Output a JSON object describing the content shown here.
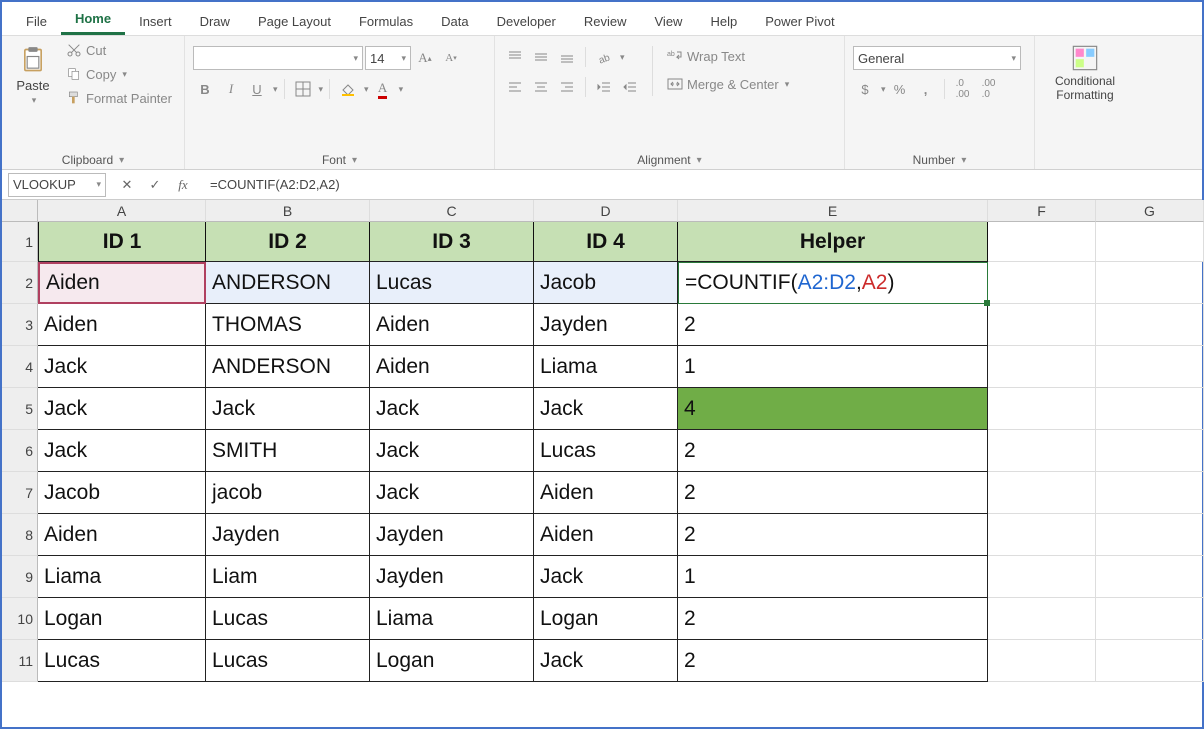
{
  "tabs": [
    "File",
    "Home",
    "Insert",
    "Draw",
    "Page Layout",
    "Formulas",
    "Data",
    "Developer",
    "Review",
    "View",
    "Help",
    "Power Pivot"
  ],
  "active_tab": "Home",
  "ribbon": {
    "clipboard": {
      "paste": "Paste",
      "cut": "Cut",
      "copy": "Copy",
      "format_painter": "Format Painter",
      "label": "Clipboard"
    },
    "font": {
      "name": "",
      "size": "14",
      "label": "Font"
    },
    "alignment": {
      "wrap": "Wrap Text",
      "merge": "Merge & Center",
      "label": "Alignment"
    },
    "number": {
      "format": "General",
      "label": "Number"
    },
    "styles": {
      "cond": "Conditional Formatting"
    }
  },
  "fbar": {
    "name": "VLOOKUP",
    "formula": "=COUNTIF(A2:D2,A2)"
  },
  "cols": [
    "A",
    "B",
    "C",
    "D",
    "E",
    "F",
    "G"
  ],
  "rows": [
    "1",
    "2",
    "3",
    "4",
    "5",
    "6",
    "7",
    "8",
    "9",
    "10",
    "11"
  ],
  "headers": [
    "ID 1",
    "ID 2",
    "ID 3",
    "ID 4",
    "Helper"
  ],
  "e2_formula": {
    "pre": "=COUNTIF(",
    "a": "A2:D2",
    "mid": ",",
    "b": "A2",
    "post": ")"
  },
  "data": [
    [
      "Aiden",
      "ANDERSON",
      "Lucas",
      "Jacob",
      ""
    ],
    [
      "Aiden",
      "THOMAS",
      "Aiden",
      "Jayden",
      "2"
    ],
    [
      "Jack",
      "ANDERSON",
      "Aiden",
      "Liama",
      "1"
    ],
    [
      "Jack",
      "Jack",
      "Jack",
      "Jack",
      "4"
    ],
    [
      "Jack",
      "SMITH",
      "Jack",
      "Lucas",
      "2"
    ],
    [
      "Jacob",
      "jacob",
      "Jack",
      "Aiden",
      "2"
    ],
    [
      "Aiden",
      "Jayden",
      "Jayden",
      "Aiden",
      "2"
    ],
    [
      "Liama",
      "Liam",
      "Jayden",
      "Jack",
      "1"
    ],
    [
      "Logan",
      "Lucas",
      "Liama",
      "Logan",
      "2"
    ],
    [
      "Lucas",
      "Lucas",
      "Logan",
      "Jack",
      "2"
    ]
  ]
}
